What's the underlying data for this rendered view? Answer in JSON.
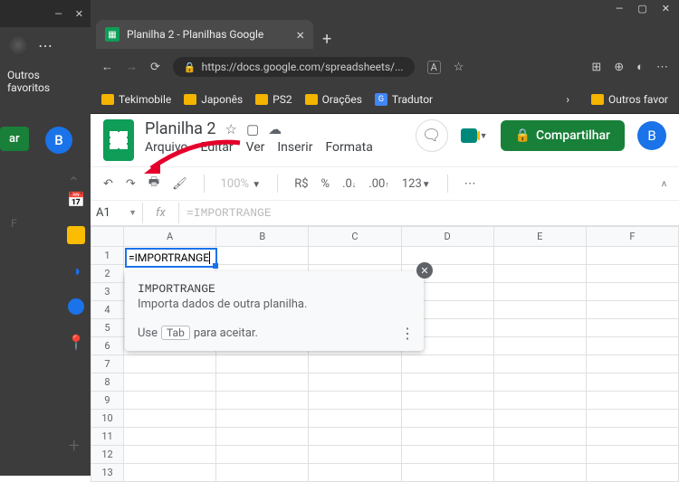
{
  "left_window": {
    "favorites_label": "Outros favoritos",
    "green_button": "ar",
    "account_initial": "B",
    "column_label": "F"
  },
  "browser": {
    "tab_title": "Planilha 2 - Planilhas Google",
    "url_display": "https://docs.google.com/spreadsheets/...",
    "url_badge": "A",
    "bookmarks": [
      "Tekimobile",
      "Japonês",
      "PS2",
      "Orações"
    ],
    "translator_label": "Tradutor",
    "other_favorites": "Outros favor"
  },
  "sheets": {
    "doc_title": "Planilha 2",
    "menus": [
      "Arquivo",
      "Editar",
      "Ver",
      "Inserir",
      "Formata"
    ],
    "share_label": "Compartilhar",
    "account_initial": "B",
    "toolbar": {
      "zoom": "100%",
      "currency": "R$",
      "percent": "%",
      "dec_dec": ".0",
      "inc_dec": ".00",
      "numfmt": "123"
    },
    "cell_ref": "A1",
    "fx_label": "fx",
    "formula_text": "=IMPORTRANGE",
    "columns": [
      "A",
      "B",
      "C",
      "D",
      "E",
      "F"
    ],
    "rows": [
      "1",
      "2",
      "3",
      "4",
      "5",
      "6",
      "7",
      "8",
      "9",
      "10",
      "11",
      "12",
      "13"
    ],
    "active_cell_text": "=IMPORTRANGE",
    "tooltip": {
      "fn_name": "IMPORTRANGE",
      "description": "Importa dados de outra planilha.",
      "hint_prefix": "Use",
      "hint_key": "Tab",
      "hint_suffix": "para aceitar."
    }
  },
  "side_apps": {
    "calendar": "📅",
    "keep": "🟨",
    "tasks": "✔",
    "contacts": "👤",
    "maps": "📍"
  }
}
